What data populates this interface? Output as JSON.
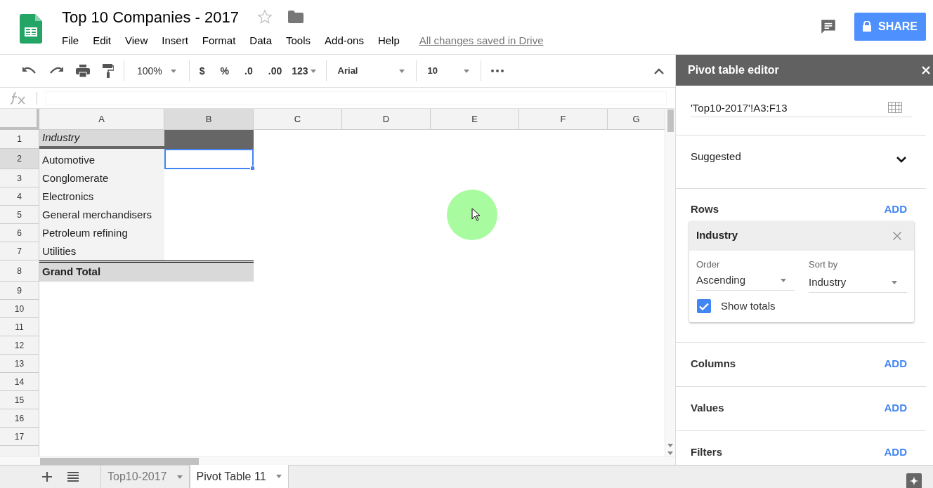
{
  "document": {
    "title": "Top 10 Companies - 2017",
    "starred": false,
    "save_status": "All changes saved in Drive"
  },
  "menu": [
    "File",
    "Edit",
    "View",
    "Insert",
    "Format",
    "Data",
    "Tools",
    "Add-ons",
    "Help"
  ],
  "share_button": "SHARE",
  "toolbar": {
    "zoom": "100%",
    "currency": "$",
    "percent": "%",
    "decrease_decimals": ".0",
    "increase_decimals": ".00",
    "number_format": "123",
    "font": "Arial",
    "font_size": "10"
  },
  "columns": [
    {
      "label": "A",
      "selected": false
    },
    {
      "label": "B",
      "selected": true
    },
    {
      "label": "C",
      "selected": false
    },
    {
      "label": "D",
      "selected": false
    },
    {
      "label": "E",
      "selected": false
    },
    {
      "label": "F",
      "selected": false
    },
    {
      "label": "G",
      "selected": false
    }
  ],
  "rows": [
    {
      "label": "1",
      "selected": false
    },
    {
      "label": "2",
      "selected": true
    },
    {
      "label": "3",
      "selected": false
    },
    {
      "label": "4",
      "selected": false
    },
    {
      "label": "5",
      "selected": false
    },
    {
      "label": "6",
      "selected": false
    },
    {
      "label": "7",
      "selected": false
    },
    {
      "label": "8",
      "selected": false
    },
    {
      "label": "9",
      "selected": false
    },
    {
      "label": "10",
      "selected": false
    },
    {
      "label": "11",
      "selected": false
    },
    {
      "label": "12",
      "selected": false
    },
    {
      "label": "13",
      "selected": false
    },
    {
      "label": "14",
      "selected": false
    },
    {
      "label": "15",
      "selected": false
    },
    {
      "label": "16",
      "selected": false
    },
    {
      "label": "17",
      "selected": false
    }
  ],
  "pivot": {
    "header": "Industry",
    "items": [
      "Automotive",
      "Conglomerate",
      "Electronics",
      "General merchandisers",
      "Petroleum refining",
      "Utilities"
    ],
    "total": "Grand Total"
  },
  "sheets": [
    {
      "name": "Top10-2017",
      "selected": false
    },
    {
      "name": "Pivot Table 11",
      "selected": true
    }
  ],
  "editor": {
    "title": "Pivot table editor",
    "range": "'Top10-2017'!A3:F13",
    "suggested": {
      "label": "Suggested",
      "expanded": false
    },
    "sections": [
      {
        "title": "Rows",
        "action": "ADD",
        "fields": [
          {
            "name": "Industry",
            "order_label": "Order",
            "order": "Ascending",
            "sort_label": "Sort by",
            "sort": "Industry",
            "totals_label": "Show totals",
            "show_totals": true
          }
        ]
      },
      {
        "title": "Columns",
        "action": "ADD"
      },
      {
        "title": "Values",
        "action": "ADD"
      },
      {
        "title": "Filters",
        "action": "ADD"
      }
    ]
  }
}
